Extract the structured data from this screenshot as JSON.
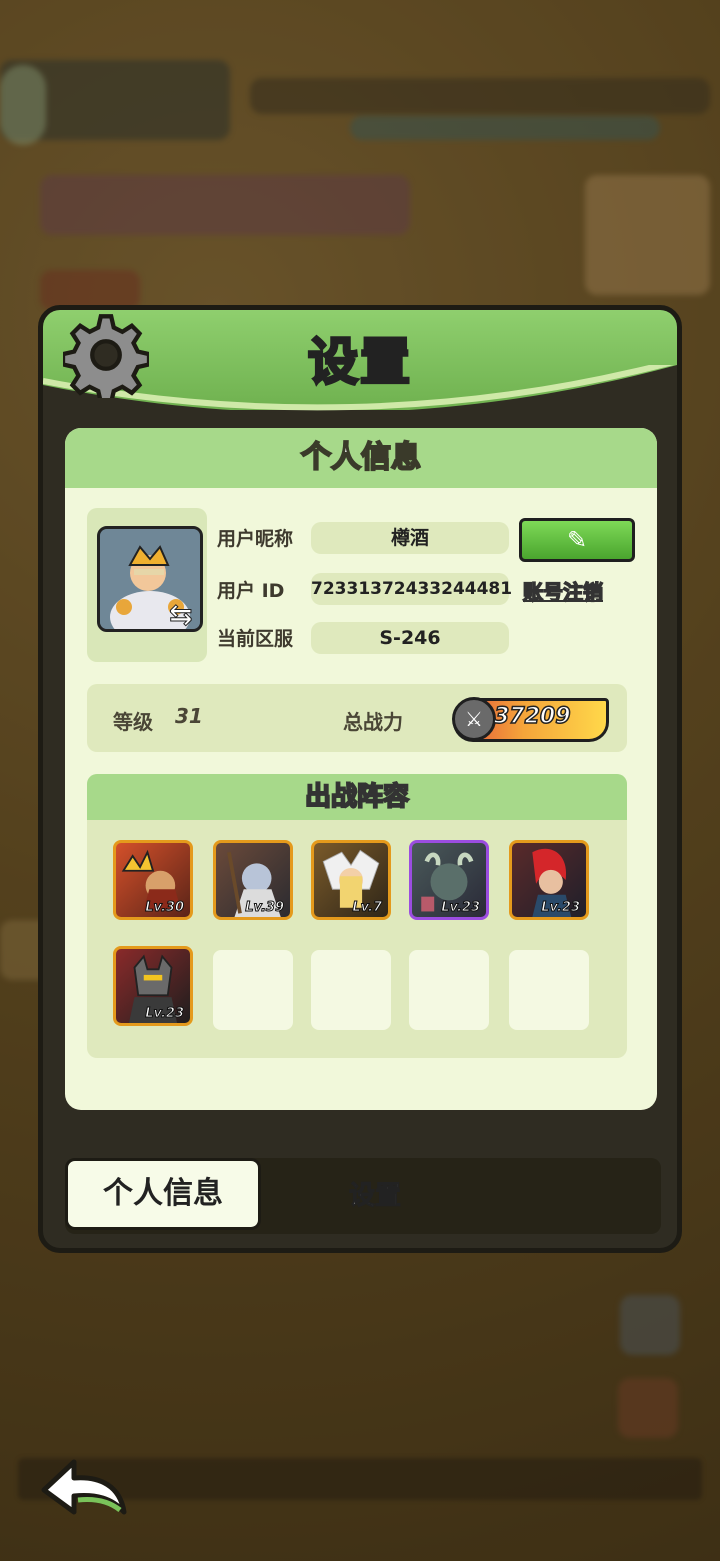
{
  "modal": {
    "title": "设置",
    "panel_title": "个人信息"
  },
  "profile": {
    "nickname_label": "用户昵称",
    "nickname": "樽酒",
    "user_id_label": "用户 ID",
    "user_id": "72331372433244481",
    "server_label": "当前区服",
    "server": "S-246",
    "cancel_account_label": "账号注销",
    "edit_icon": "pencil-icon"
  },
  "stats": {
    "level_label": "等级",
    "level": "31",
    "power_label": "总战力",
    "power": "37209"
  },
  "lineup": {
    "title": "出战阵容",
    "heroes": [
      {
        "level": "Lv.30",
        "frame": "orange"
      },
      {
        "level": "Lv.39",
        "frame": "orange"
      },
      {
        "level": "Lv.7",
        "frame": "orange"
      },
      {
        "level": "Lv.23",
        "frame": "purple"
      },
      {
        "level": "Lv.23",
        "frame": "orange"
      },
      {
        "level": "Lv.23",
        "frame": "orange"
      }
    ],
    "empty_slots": 4
  },
  "tabs": {
    "active": "个人信息",
    "inactive": "设置"
  },
  "colors": {
    "accent_green": "#8fcf6e",
    "panel_bg": "#f1f8da",
    "frame_orange": "#e49a1c",
    "frame_purple": "#9b4de0"
  }
}
